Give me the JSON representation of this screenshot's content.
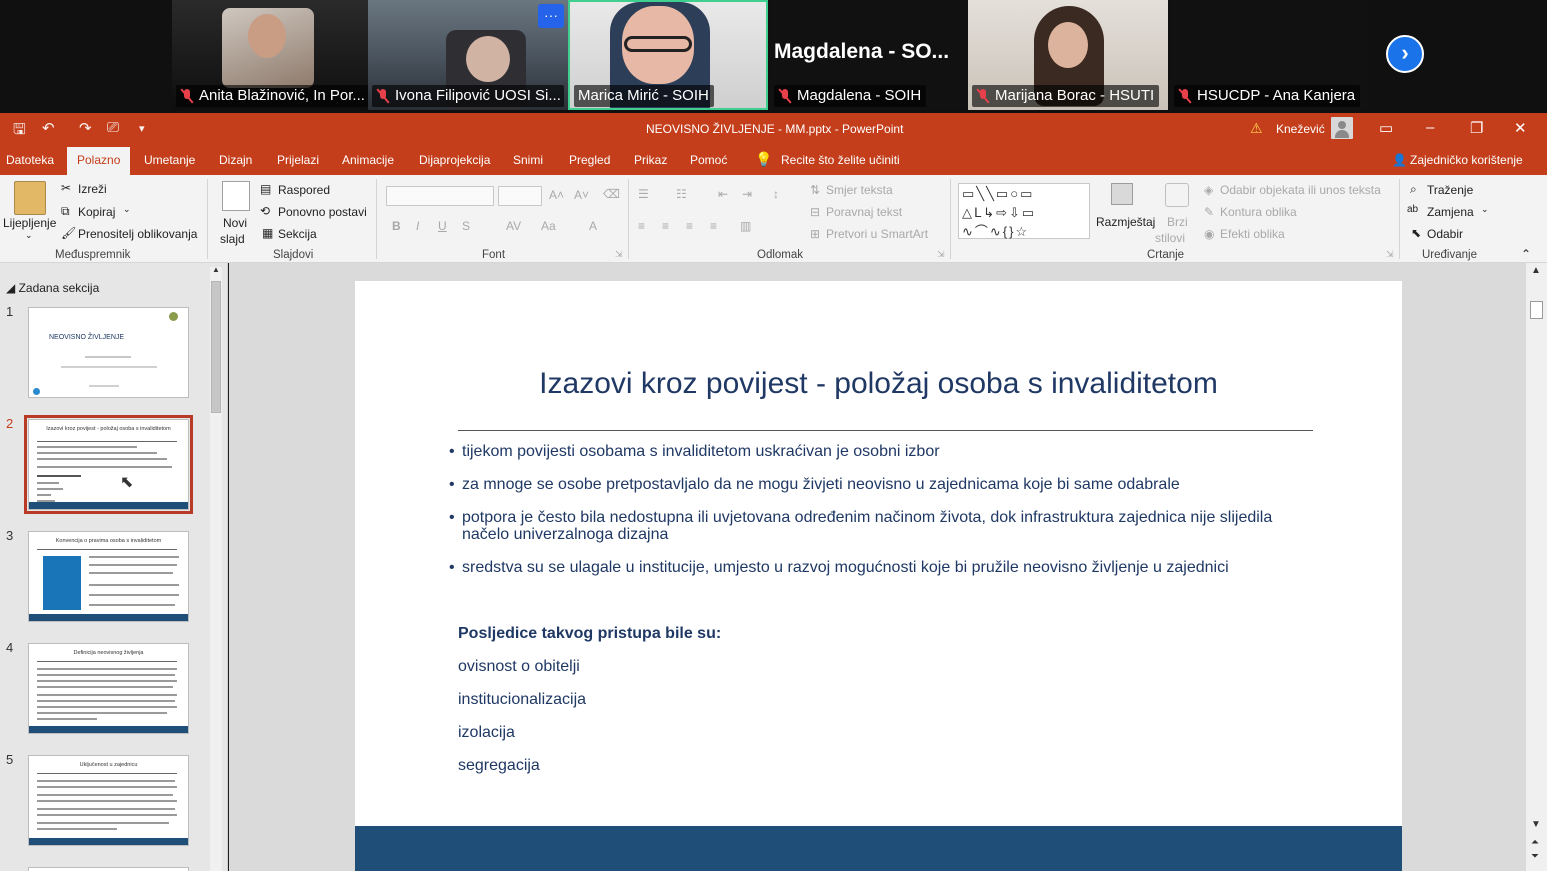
{
  "meeting": {
    "participants": [
      {
        "name": "Anita Blažinović, In Por...",
        "muted": true
      },
      {
        "name": "Ivona Filipović UOSI Si...",
        "muted": true
      },
      {
        "name": "Marica Mirić - SOIH",
        "muted": false,
        "speaking": true
      },
      {
        "name": "Magdalena - SOIH",
        "muted": true,
        "display_name": "Magdalena  - SO..."
      },
      {
        "name": "Marijana Borac - HSUTI",
        "muted": true
      },
      {
        "name": "HSUCDP - Ana Kanjera",
        "muted": true
      }
    ],
    "more_label": "···",
    "next_label": "›"
  },
  "app": {
    "window_title": "NEOVISNO ŽIVLJENJE - MM.pptx  -  PowerPoint",
    "warning_icon": "warning-icon",
    "user_name": "Knežević",
    "tabs": [
      "Datoteka",
      "Polazno",
      "Umetanje",
      "Dizajn",
      "Prijelazi",
      "Animacije",
      "Dijaprojekcija",
      "Snimi",
      "Pregled",
      "Prikaz",
      "Pomoć"
    ],
    "active_tab": "Polazno",
    "tell_me": "Recite što želite učiniti",
    "share": "Zajedničko korištenje"
  },
  "ribbon": {
    "clipboard": {
      "paste": "Lijepljenje",
      "cut": "Izreži",
      "copy": "Kopiraj",
      "format_painter": "Prenositelj oblikovanja",
      "label": "Međuspremnik"
    },
    "slides": {
      "new_slide_1": "Novi",
      "new_slide_2": "slajd",
      "layout": "Raspored",
      "reset": "Ponovno postavi",
      "section": "Sekcija",
      "label": "Slajdovi"
    },
    "font": {
      "bold": "B",
      "italic": "I",
      "underline": "U",
      "strike": "S",
      "spacing": "AV",
      "case": "Aa",
      "color": "A",
      "grow": "A˄",
      "shrink": "A˅",
      "label": "Font"
    },
    "paragraph": {
      "text_direction": "Smjer teksta",
      "align_text": "Poravnaj tekst",
      "smartart": "Pretvori u SmartArt",
      "label": "Odlomak"
    },
    "drawing": {
      "arrange": "Razmještaj",
      "quick_styles_1": "Brzi",
      "quick_styles_2": "stilovi",
      "shape_fill": "Odabir objekata ili unos teksta",
      "shape_outline": "Kontura oblika",
      "shape_effects": "Efekti oblika",
      "label": "Crtanje"
    },
    "editing": {
      "find": "Traženje",
      "replace": "Zamjena",
      "select": "Odabir",
      "label": "Uređivanje"
    }
  },
  "thumbnails": {
    "section_title": "Zadana sekcija",
    "slides": [
      {
        "num": "1",
        "title": "NEOVISNO ŽIVLJENJE"
      },
      {
        "num": "2",
        "title": "Izazovi kroz povijest - položaj osoba s invaliditetom"
      },
      {
        "num": "3",
        "title": "Konvencija o pravima osoba s invaliditetom"
      },
      {
        "num": "4",
        "title": "Definicija neovisnog življenja"
      },
      {
        "num": "5",
        "title": "Uključenost u zajednicu"
      }
    ],
    "selected": "2"
  },
  "slide": {
    "title": "Izazovi kroz povijest - položaj osoba s invaliditetom",
    "bullets": [
      "tijekom povijesti osobama s invaliditetom uskraćivan je osobni izbor",
      "za mnoge se osobe pretpostavljalo da ne mogu živjeti neovisno u zajednicama koje bi same odabrale",
      "potpora je često bila nedostupna ili uvjetovana određenim načinom života, dok infrastruktura zajednica nije slijedila načelo univerzalnoga dizajna",
      "sredstva su se ulagale u institucije, umjesto u razvoj mogućnosti koje bi pružile neovisno življenje u zajednici"
    ],
    "consequences_heading": "Posljedice takvog pristupa bile su:",
    "consequences": [
      "ovisnost o obitelji",
      "institucionalizacija",
      "izolacija",
      "segregacija"
    ],
    "accent_color": "#1f4e79"
  }
}
